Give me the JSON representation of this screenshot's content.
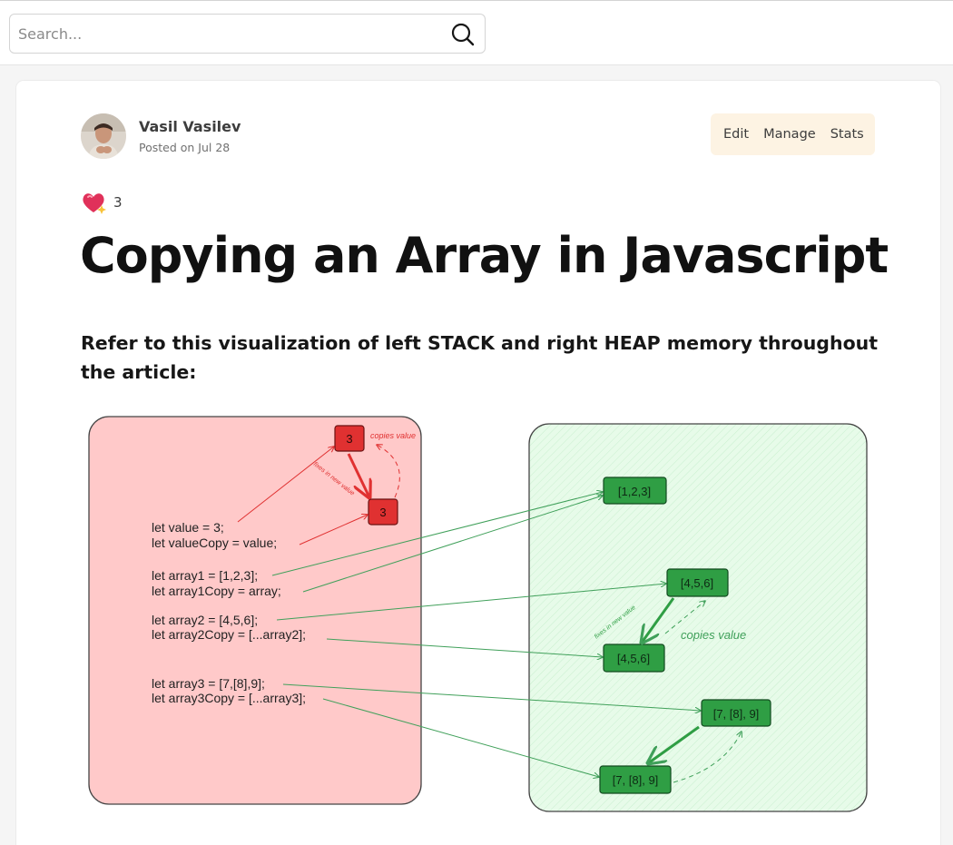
{
  "search": {
    "placeholder": "Search..."
  },
  "author": {
    "name": "Vasil Vasilev",
    "posted": "Posted on Jul 28"
  },
  "actions": [
    "Edit",
    "Manage",
    "Stats"
  ],
  "reactions": {
    "icon": "sparkle-heart-icon",
    "count": "3"
  },
  "article": {
    "title": "Copying an Array in Javascript",
    "subheading": "Refer to this visualization of left STACK and right HEAP memory throughout the article:"
  },
  "diagram": {
    "stack_lines": [
      "let value = 3;",
      "let valueCopy = value;",
      "let array1 = [1,2,3];",
      "let array1Copy = array;",
      "let array2 = [4,5,6];",
      "let array2Copy = [...array2];",
      "let array3 = [7,[8],9];",
      "let array3Copy = [...array3];"
    ],
    "stack_values": [
      "3",
      "3"
    ],
    "heap_values": [
      "[1,2,3]",
      "[4,5,6]",
      "[4,5,6]",
      "[7, [8], 9]",
      "[7, [8], 9]"
    ],
    "annotations": {
      "copies_value_stack": "copies value",
      "fixes_new_value_stack": "fixes in new value",
      "copies_value_heap": "copies value",
      "fixes_new_value_heap": "fixes in new value"
    },
    "colors": {
      "stack_fill": "#ffc9c9",
      "heap_fill": "#e3fae6",
      "red_box": "#e03131",
      "green_box": "#2f9e44",
      "red_arrow": "#e03131",
      "green_arrow": "#40a05a"
    }
  }
}
